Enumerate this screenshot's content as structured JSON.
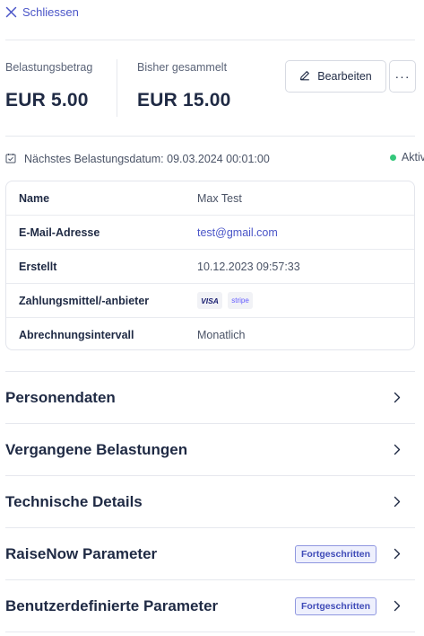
{
  "close": {
    "label": "Schliessen",
    "icon": "close-icon"
  },
  "stats": {
    "charge_amount": {
      "label": "Belastungsbetrag",
      "value": "EUR 5.00"
    },
    "collected": {
      "label": "Bisher gesammelt",
      "value": "EUR 15.00"
    }
  },
  "actions": {
    "edit_label": "Bearbeiten",
    "more_label": "···"
  },
  "next_charge": {
    "text": "Nächstes Belastungsdatum: 09.03.2024 00:01:00"
  },
  "status": {
    "label": "Aktiv",
    "color": "#34c77b"
  },
  "details": {
    "rows": [
      {
        "key": "Name",
        "value": "Max Test"
      },
      {
        "key": "E-Mail-Adresse",
        "value": "test@gmail.com"
      },
      {
        "key": "Erstellt",
        "value": "10.12.2023 09:57:33"
      },
      {
        "key": "Zahlungsmittel/-anbieter",
        "value": ""
      },
      {
        "key": "Abrechnungsintervall",
        "value": "Monatlich"
      }
    ],
    "payment_methods": [
      "VISA",
      "stripe"
    ]
  },
  "sections": [
    {
      "title": "Personendaten",
      "tag": ""
    },
    {
      "title": "Vergangene Belastungen",
      "tag": ""
    },
    {
      "title": "Technische Details",
      "tag": ""
    },
    {
      "title": "RaiseNow Parameter",
      "tag": "Fortgeschritten"
    },
    {
      "title": "Benutzerdefinierte Parameter",
      "tag": "Fortgeschritten"
    }
  ],
  "colors": {
    "accent": "#4a55c8",
    "text": "#1f2a44",
    "tag_bg": "#eef0fd"
  }
}
